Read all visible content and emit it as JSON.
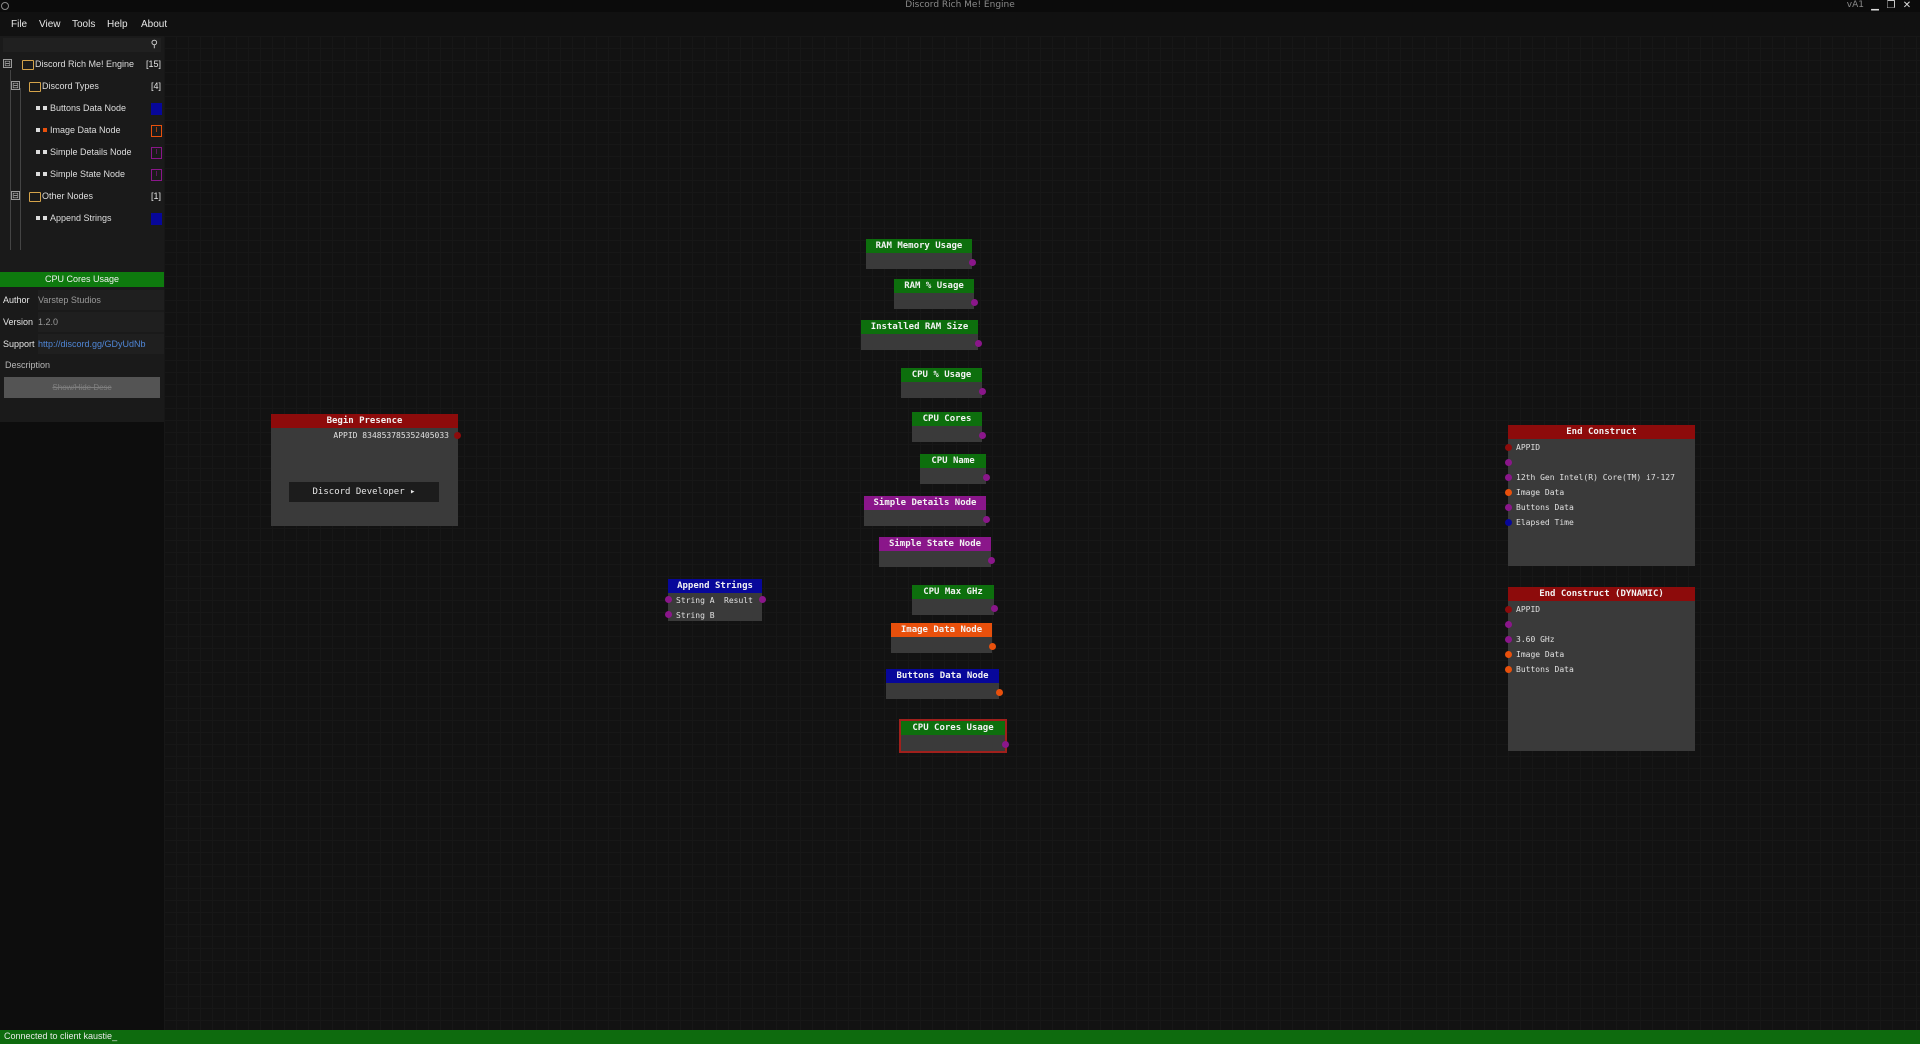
{
  "window": {
    "title": "Discord Rich Me! Engine",
    "version": "vA1",
    "min_glyph": "▁",
    "restore_glyph": "❐",
    "close_glyph": "✕"
  },
  "menu": [
    "File",
    "View",
    "Tools",
    "Help",
    "About"
  ],
  "search": {
    "icon_glyph": "⚲"
  },
  "tree": {
    "root": {
      "label": "Discord Rich Me! Engine",
      "count": "[15]",
      "toggle": "⊟"
    },
    "groups": [
      {
        "label": "Discord Types",
        "count": "[4]",
        "toggle": "⊟",
        "items": [
          {
            "label": "Buttons Data Node",
            "chip": "",
            "chip_color": "#07079a"
          },
          {
            "label": "Image Data Node",
            "chip": "I",
            "chip_color": "#e8500c"
          },
          {
            "label": "Simple Details Node",
            "chip": "I",
            "chip_color": "#8a168a"
          },
          {
            "label": "Simple State Node",
            "chip": "I",
            "chip_color": "#8a168a"
          }
        ]
      },
      {
        "label": "Other Nodes",
        "count": "[1]",
        "toggle": "⊟",
        "items": [
          {
            "label": "Append Strings",
            "chip": "",
            "chip_color": "#07079a"
          }
        ]
      }
    ]
  },
  "properties": {
    "title": "CPU Cores Usage",
    "author_label": "Author",
    "author": "Varstep Studios",
    "version_label": "Version",
    "version": "1.2.0",
    "support_label": "Support",
    "support": "http://discord.gg/GDyUdNb",
    "description_label": "Description",
    "description_button": "Show/Hide Desc"
  },
  "status": "Connected to client kaustie_",
  "nodes": {
    "begin": {
      "title": "Begin Presence",
      "appid": "APPID 834853785352405033",
      "button": "Discord Developer ▸"
    },
    "append": {
      "title": "Append Strings",
      "row1": "String A",
      "row1_out": "Result",
      "row2": "String B"
    },
    "ram_mem": {
      "title": "RAM Memory Usage"
    },
    "ram_pct": {
      "title": "RAM % Usage"
    },
    "ram_size": {
      "title": "Installed RAM Size"
    },
    "cpu_pct": {
      "title": "CPU % Usage"
    },
    "cpu_cores": {
      "title": "CPU Cores"
    },
    "cpu_name": {
      "title": "CPU Name"
    },
    "simple_details": {
      "title": "Simple Details Node"
    },
    "simple_state": {
      "title": "Simple State Node"
    },
    "cpu_max": {
      "title": "CPU Max GHz"
    },
    "image_data": {
      "title": "Image Data Node"
    },
    "buttons_data": {
      "title": "Buttons Data Node"
    },
    "cpu_cores_usage": {
      "title": "CPU Cores Usage"
    },
    "end1": {
      "title": "End Construct",
      "rows": [
        "APPID",
        "",
        "12th Gen Intel(R) Core(TM) i7-127",
        "Image Data",
        "Buttons Data",
        "Elapsed Time"
      ]
    },
    "end2": {
      "title": "End Construct (DYNAMIC)",
      "rows": [
        "APPID",
        "",
        "3.60 GHz",
        "Image Data",
        "Buttons Data"
      ]
    }
  }
}
